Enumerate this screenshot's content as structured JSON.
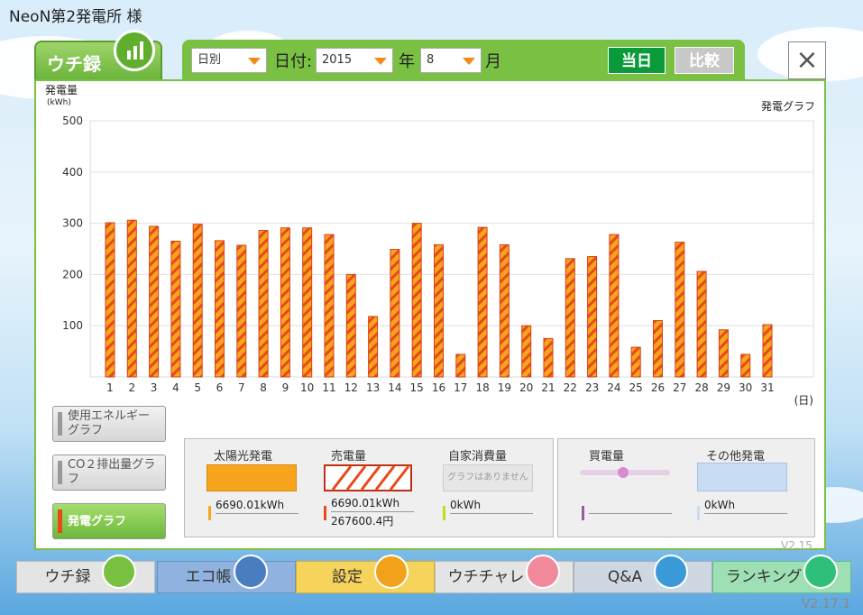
{
  "window": {
    "title": "NeoN第2発電所 様"
  },
  "tab": {
    "label": "ウチ録"
  },
  "toolbar": {
    "mode": "日別",
    "date_label": "日付:",
    "year_value": "2015",
    "year_label": "年",
    "month_value": "8",
    "month_label": "月",
    "today_button": "当日",
    "compare_button": "比較"
  },
  "close_label": "×",
  "chart_data": {
    "type": "bar",
    "title": "発電グラフ",
    "ylabel": "発電量",
    "yunit": "(kWh)",
    "xunit": "(日)",
    "ylim": [
      0,
      500
    ],
    "yticks": [
      "100",
      "200",
      "300",
      "400",
      "500"
    ],
    "categories": [
      "1",
      "2",
      "3",
      "4",
      "5",
      "6",
      "7",
      "8",
      "9",
      "10",
      "11",
      "12",
      "13",
      "14",
      "15",
      "16",
      "17",
      "18",
      "19",
      "20",
      "21",
      "22",
      "23",
      "24",
      "25",
      "26",
      "27",
      "28",
      "29",
      "30",
      "31"
    ],
    "values": [
      301,
      306,
      294,
      265,
      298,
      266,
      257,
      286,
      291,
      291,
      278,
      200,
      118,
      249,
      300,
      258,
      44,
      292,
      258,
      100,
      75,
      231,
      235,
      278,
      58,
      110,
      263,
      206,
      92,
      44,
      102
    ],
    "bar_color": "#f7a51c",
    "stripe_color": "#e8491a"
  },
  "side_buttons": {
    "energy": "使用エネルギーグラフ",
    "co2": "CO２排出量グラフ",
    "generation": "発電グラフ"
  },
  "legend": {
    "solar": {
      "title": "太陽光発電",
      "value": "6690.01kWh"
    },
    "sold": {
      "title": "売電量",
      "value": "6690.01kWh",
      "value2": "267600.4円"
    },
    "self": {
      "title": "自家消費量",
      "note": "グラフはありません",
      "value": "0kWh"
    },
    "bought": {
      "title": "買電量",
      "value": ""
    },
    "other": {
      "title": "その他発電",
      "value": "0kWh"
    }
  },
  "nav": {
    "uchiroku": "ウチ録",
    "ecocho": "エコ帳",
    "settings": "設定",
    "challenge": "ウチチャレ",
    "qa": "Q&A",
    "ranking": "ランキング"
  },
  "version": "V2.17.1",
  "version_bg": "V2.15"
}
